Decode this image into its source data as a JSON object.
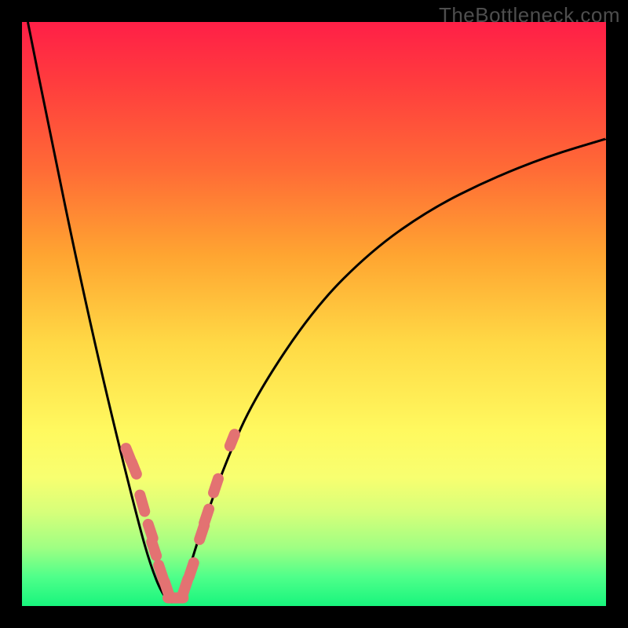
{
  "watermark": "TheBottleneck.com",
  "colors": {
    "background": "#000000",
    "gradient_top": "#ff1f47",
    "gradient_bottom": "#18f57d",
    "curve_stroke": "#000000",
    "dots": "#e37272"
  },
  "chart_data": {
    "type": "line",
    "title": "",
    "xlabel": "",
    "ylabel": "",
    "xlim": [
      0,
      100
    ],
    "ylim": [
      0,
      100
    ],
    "grid": false,
    "series": [
      {
        "name": "bottleneck-curve",
        "x": [
          1,
          5,
          10,
          15,
          20,
          22,
          24,
          26,
          28,
          30,
          35,
          40,
          50,
          60,
          70,
          80,
          90,
          100
        ],
        "y": [
          100,
          80,
          56,
          34,
          14,
          7,
          2,
          0,
          4,
          11,
          25,
          36,
          51,
          61,
          68,
          73,
          77,
          80
        ]
      }
    ],
    "dashed_segments": [
      {
        "name": "left-1",
        "x": [
          17.8,
          18.6
        ],
        "y": [
          27.0,
          25.0
        ]
      },
      {
        "name": "left-2",
        "x": [
          18.8,
          19.6
        ],
        "y": [
          24.6,
          22.6
        ]
      },
      {
        "name": "left-3",
        "x": [
          20.2,
          21.0
        ],
        "y": [
          19.0,
          16.2
        ]
      },
      {
        "name": "left-4",
        "x": [
          21.6,
          22.4
        ],
        "y": [
          14.0,
          11.6
        ]
      },
      {
        "name": "left-5",
        "x": [
          22.2,
          23.0
        ],
        "y": [
          11.0,
          8.6
        ]
      },
      {
        "name": "left-6",
        "x": [
          23.4,
          24.2
        ],
        "y": [
          7.0,
          4.6
        ]
      },
      {
        "name": "left-7",
        "x": [
          24.4,
          25.2
        ],
        "y": [
          4.2,
          1.8
        ]
      },
      {
        "name": "bottom",
        "x": [
          25.0,
          27.6
        ],
        "y": [
          1.4,
          1.4
        ]
      },
      {
        "name": "right-1",
        "x": [
          27.6,
          28.4
        ],
        "y": [
          2.2,
          4.6
        ]
      },
      {
        "name": "right-2",
        "x": [
          28.6,
          29.4
        ],
        "y": [
          5.0,
          7.4
        ]
      },
      {
        "name": "right-3",
        "x": [
          30.4,
          31.2
        ],
        "y": [
          11.4,
          13.8
        ]
      },
      {
        "name": "right-4",
        "x": [
          31.2,
          32.0
        ],
        "y": [
          14.2,
          16.6
        ]
      },
      {
        "name": "right-5",
        "x": [
          32.8,
          33.6
        ],
        "y": [
          19.4,
          21.8
        ]
      },
      {
        "name": "right-6",
        "x": [
          35.6,
          36.4
        ],
        "y": [
          27.4,
          29.4
        ]
      }
    ]
  }
}
